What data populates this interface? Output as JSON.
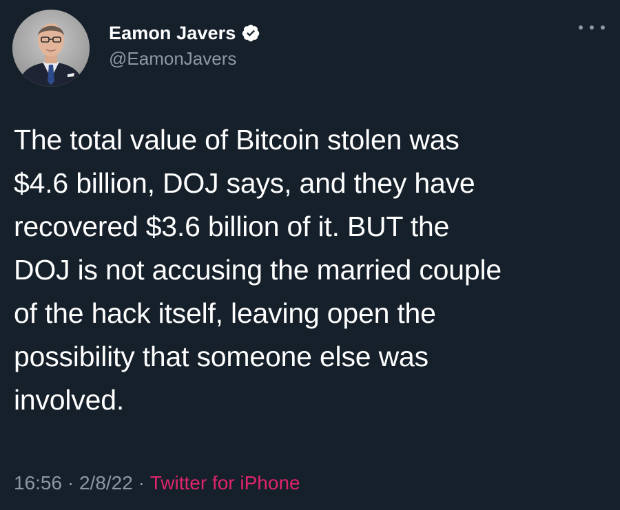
{
  "author": {
    "display_name": "Eamon Javers",
    "handle": "@EamonJavers",
    "verified": true,
    "avatar_icon": "person-avatar"
  },
  "tweet": {
    "text": "The total value of Bitcoin stolen was\n$4.6 billion, DOJ says, and they have\nrecovered $3.6 billion of it. BUT the\nDOJ is not accusing the married couple\nof the hack itself, leaving open the\npossibility that someone else was\ninvolved."
  },
  "meta": {
    "time": "16:56",
    "separator1": " · ",
    "date": "2/8/22",
    "separator2": " · ",
    "source": "Twitter for iPhone"
  },
  "colors": {
    "background": "#15202b",
    "text": "#ffffff",
    "secondary": "#8b98a5",
    "source_link": "#e0246b",
    "verified_badge": "#ffffff"
  },
  "icons": {
    "more": "more-options-icon",
    "verified": "verified-badge-icon"
  }
}
